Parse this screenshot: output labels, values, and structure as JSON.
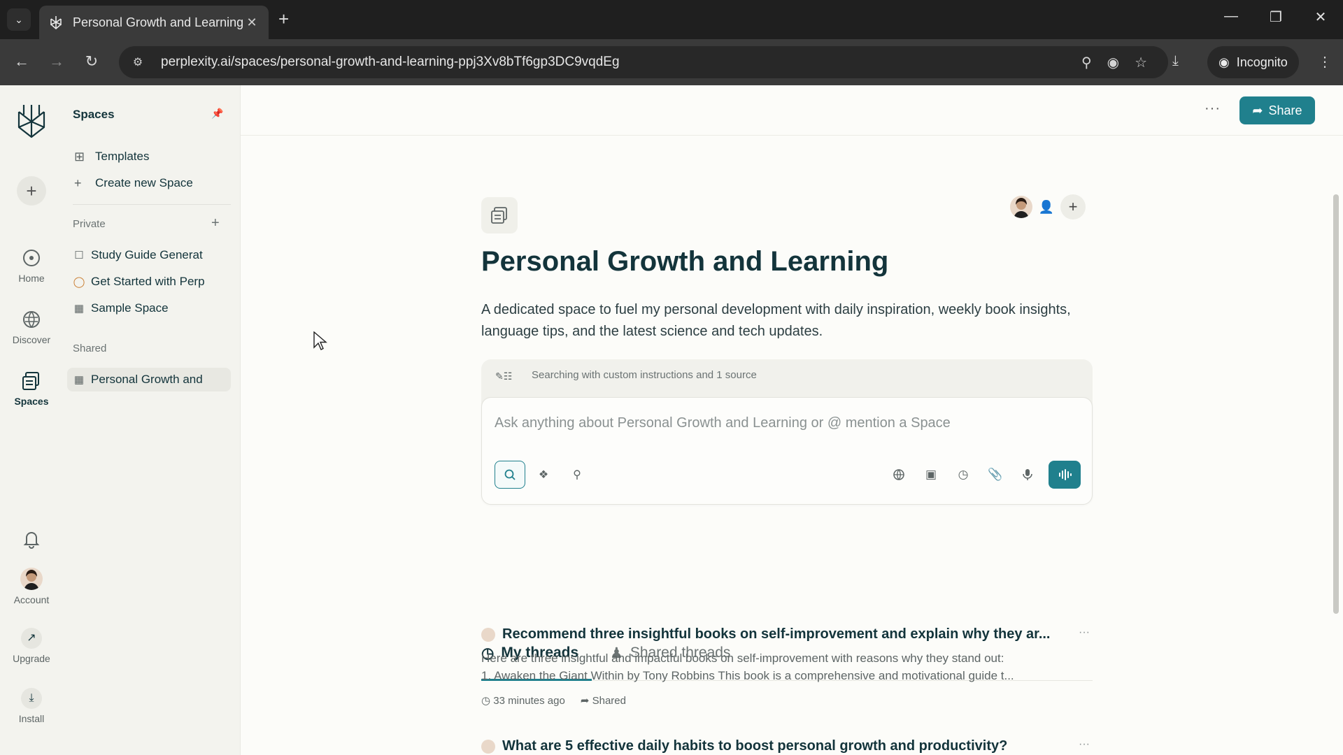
{
  "browser": {
    "tab_title": "Personal Growth and Learning",
    "url": "perplexity.ai/spaces/personal-growth-and-learning-ppj3Xv8bTf6gp3DC9vqdEg",
    "incognito_label": "Incognito"
  },
  "rail": {
    "items": [
      {
        "label": "Home",
        "icon": "home-icon"
      },
      {
        "label": "Discover",
        "icon": "discover-icon"
      },
      {
        "label": "Spaces",
        "icon": "spaces-icon"
      }
    ],
    "bottom": [
      {
        "label": "Account",
        "icon": "avatar"
      },
      {
        "label": "Upgrade",
        "icon": "upgrade-icon"
      },
      {
        "label": "Install",
        "icon": "install-icon"
      }
    ]
  },
  "sidepanel": {
    "title": "Spaces",
    "links": [
      {
        "label": "Templates",
        "icon": "templates-icon"
      },
      {
        "label": "Create new Space",
        "icon": "plus-icon"
      }
    ],
    "private_label": "Private",
    "private_spaces": [
      {
        "label": "Study Guide Generat",
        "icon": "square-icon"
      },
      {
        "label": "Get Started with Perp",
        "icon": "spark-icon"
      },
      {
        "label": "Sample Space",
        "icon": "space-icon"
      }
    ],
    "shared_label": "Shared",
    "shared_spaces": [
      {
        "label": "Personal Growth and",
        "icon": "space-icon"
      }
    ]
  },
  "header": {
    "more_label": "···",
    "share_label": "Share"
  },
  "space": {
    "title": "Personal Growth and Learning",
    "description": "A dedicated space to fuel my personal development with daily inspiration, weekly book insights, language tips, and the latest science and tech updates."
  },
  "ask": {
    "status": "Searching with custom instructions and 1 source",
    "placeholder": "Ask anything about Personal Growth and Learning or @ mention a Space",
    "value": ""
  },
  "tabs": {
    "my_threads": "My threads",
    "shared_threads": "Shared threads"
  },
  "threads": [
    {
      "title": "Recommend three insightful books on self-improvement and explain why they ar...",
      "snippet_line1": "Here are three insightful and impactful books on self-improvement with reasons why they stand out:",
      "snippet_line2": "1. Awaken the Giant Within by Tony Robbins This book is a comprehensive and motivational guide t...",
      "time": "33 minutes ago",
      "status": "Shared"
    },
    {
      "title": "What are 5 effective daily habits to boost personal growth and productivity?"
    }
  ],
  "colors": {
    "accent": "#20808d",
    "text": "#13343b",
    "sidebar_bg": "#f3f3ee"
  }
}
